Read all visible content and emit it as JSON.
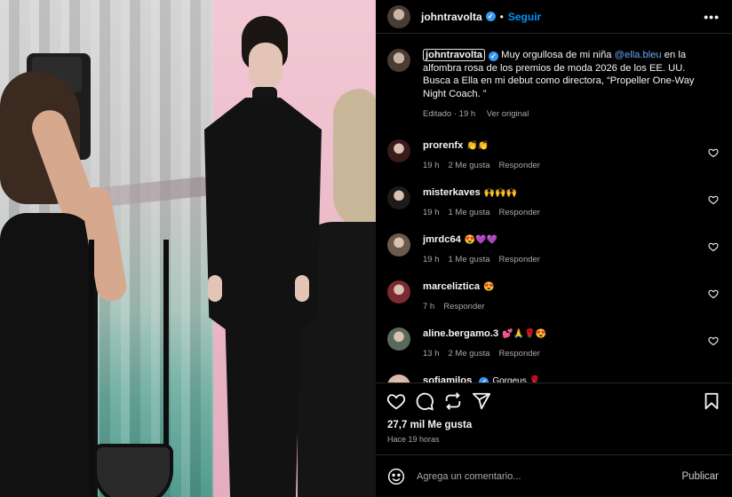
{
  "colors": {
    "background": "#000000",
    "verified": "#3897f0",
    "link": "#0095f6",
    "mention": "#6aa9f5",
    "muted": "#a8a8a8",
    "divider": "#262626"
  },
  "header": {
    "username": "johntravolta",
    "separator": "•",
    "follow_label": "Seguir",
    "more_label": "•••"
  },
  "caption": {
    "username": "johntravolta",
    "text_before": " Muy orgullosa de mi niña ",
    "mention": "@ella.bleu",
    "text_after": " en la alfombra rosa de los premios de moda 2026 de los EE. UU. Busca a Ella en mi debut como directora, “Propeller One-Way Night Coach. ”",
    "edited": "Editado · 19 h",
    "see_original": "Ver original"
  },
  "comments": [
    {
      "username": "prorenfx",
      "text": "👏👏",
      "time": "19 h",
      "likes": "2 Me gusta",
      "reply": "Responder",
      "verified": false,
      "avatar": "#3b1a1a"
    },
    {
      "username": "misterkaves",
      "text": "🙌🙌🙌",
      "time": "19 h",
      "likes": "1 Me gusta",
      "reply": "Responder",
      "verified": false,
      "avatar": "#1f1a1a"
    },
    {
      "username": "jmrdc64",
      "text": "😍💜💜",
      "time": "19 h",
      "likes": "1 Me gusta",
      "reply": "Responder",
      "verified": false,
      "avatar": "#6b5a4a"
    },
    {
      "username": "marceliztica",
      "text": "😍",
      "time": "7 h",
      "likes": "",
      "reply": "Responder",
      "verified": false,
      "avatar": "#7a2a30"
    },
    {
      "username": "aline.bergamo.3",
      "text": "💕🙏🌹😍",
      "time": "13 h",
      "likes": "2 Me gusta",
      "reply": "Responder",
      "verified": false,
      "avatar": "#5a6a5a"
    },
    {
      "username": "sofiamilos",
      "text": "Gorgeus 🌹",
      "time": "",
      "likes": "",
      "reply": "",
      "verified": true,
      "avatar": "#d8b8a8"
    }
  ],
  "actions": {
    "like_icon": "heart-icon",
    "comment_icon": "comment-icon",
    "share_icon": "repost-icon",
    "send_icon": "send-icon",
    "save_icon": "bookmark-icon"
  },
  "likes_count": "27,7 mil Me gusta",
  "posted_time": "Hace 19 horas",
  "add_comment": {
    "placeholder": "Agrega un comentario...",
    "post_label": "Publicar",
    "emoji_icon": "emoji-icon"
  }
}
